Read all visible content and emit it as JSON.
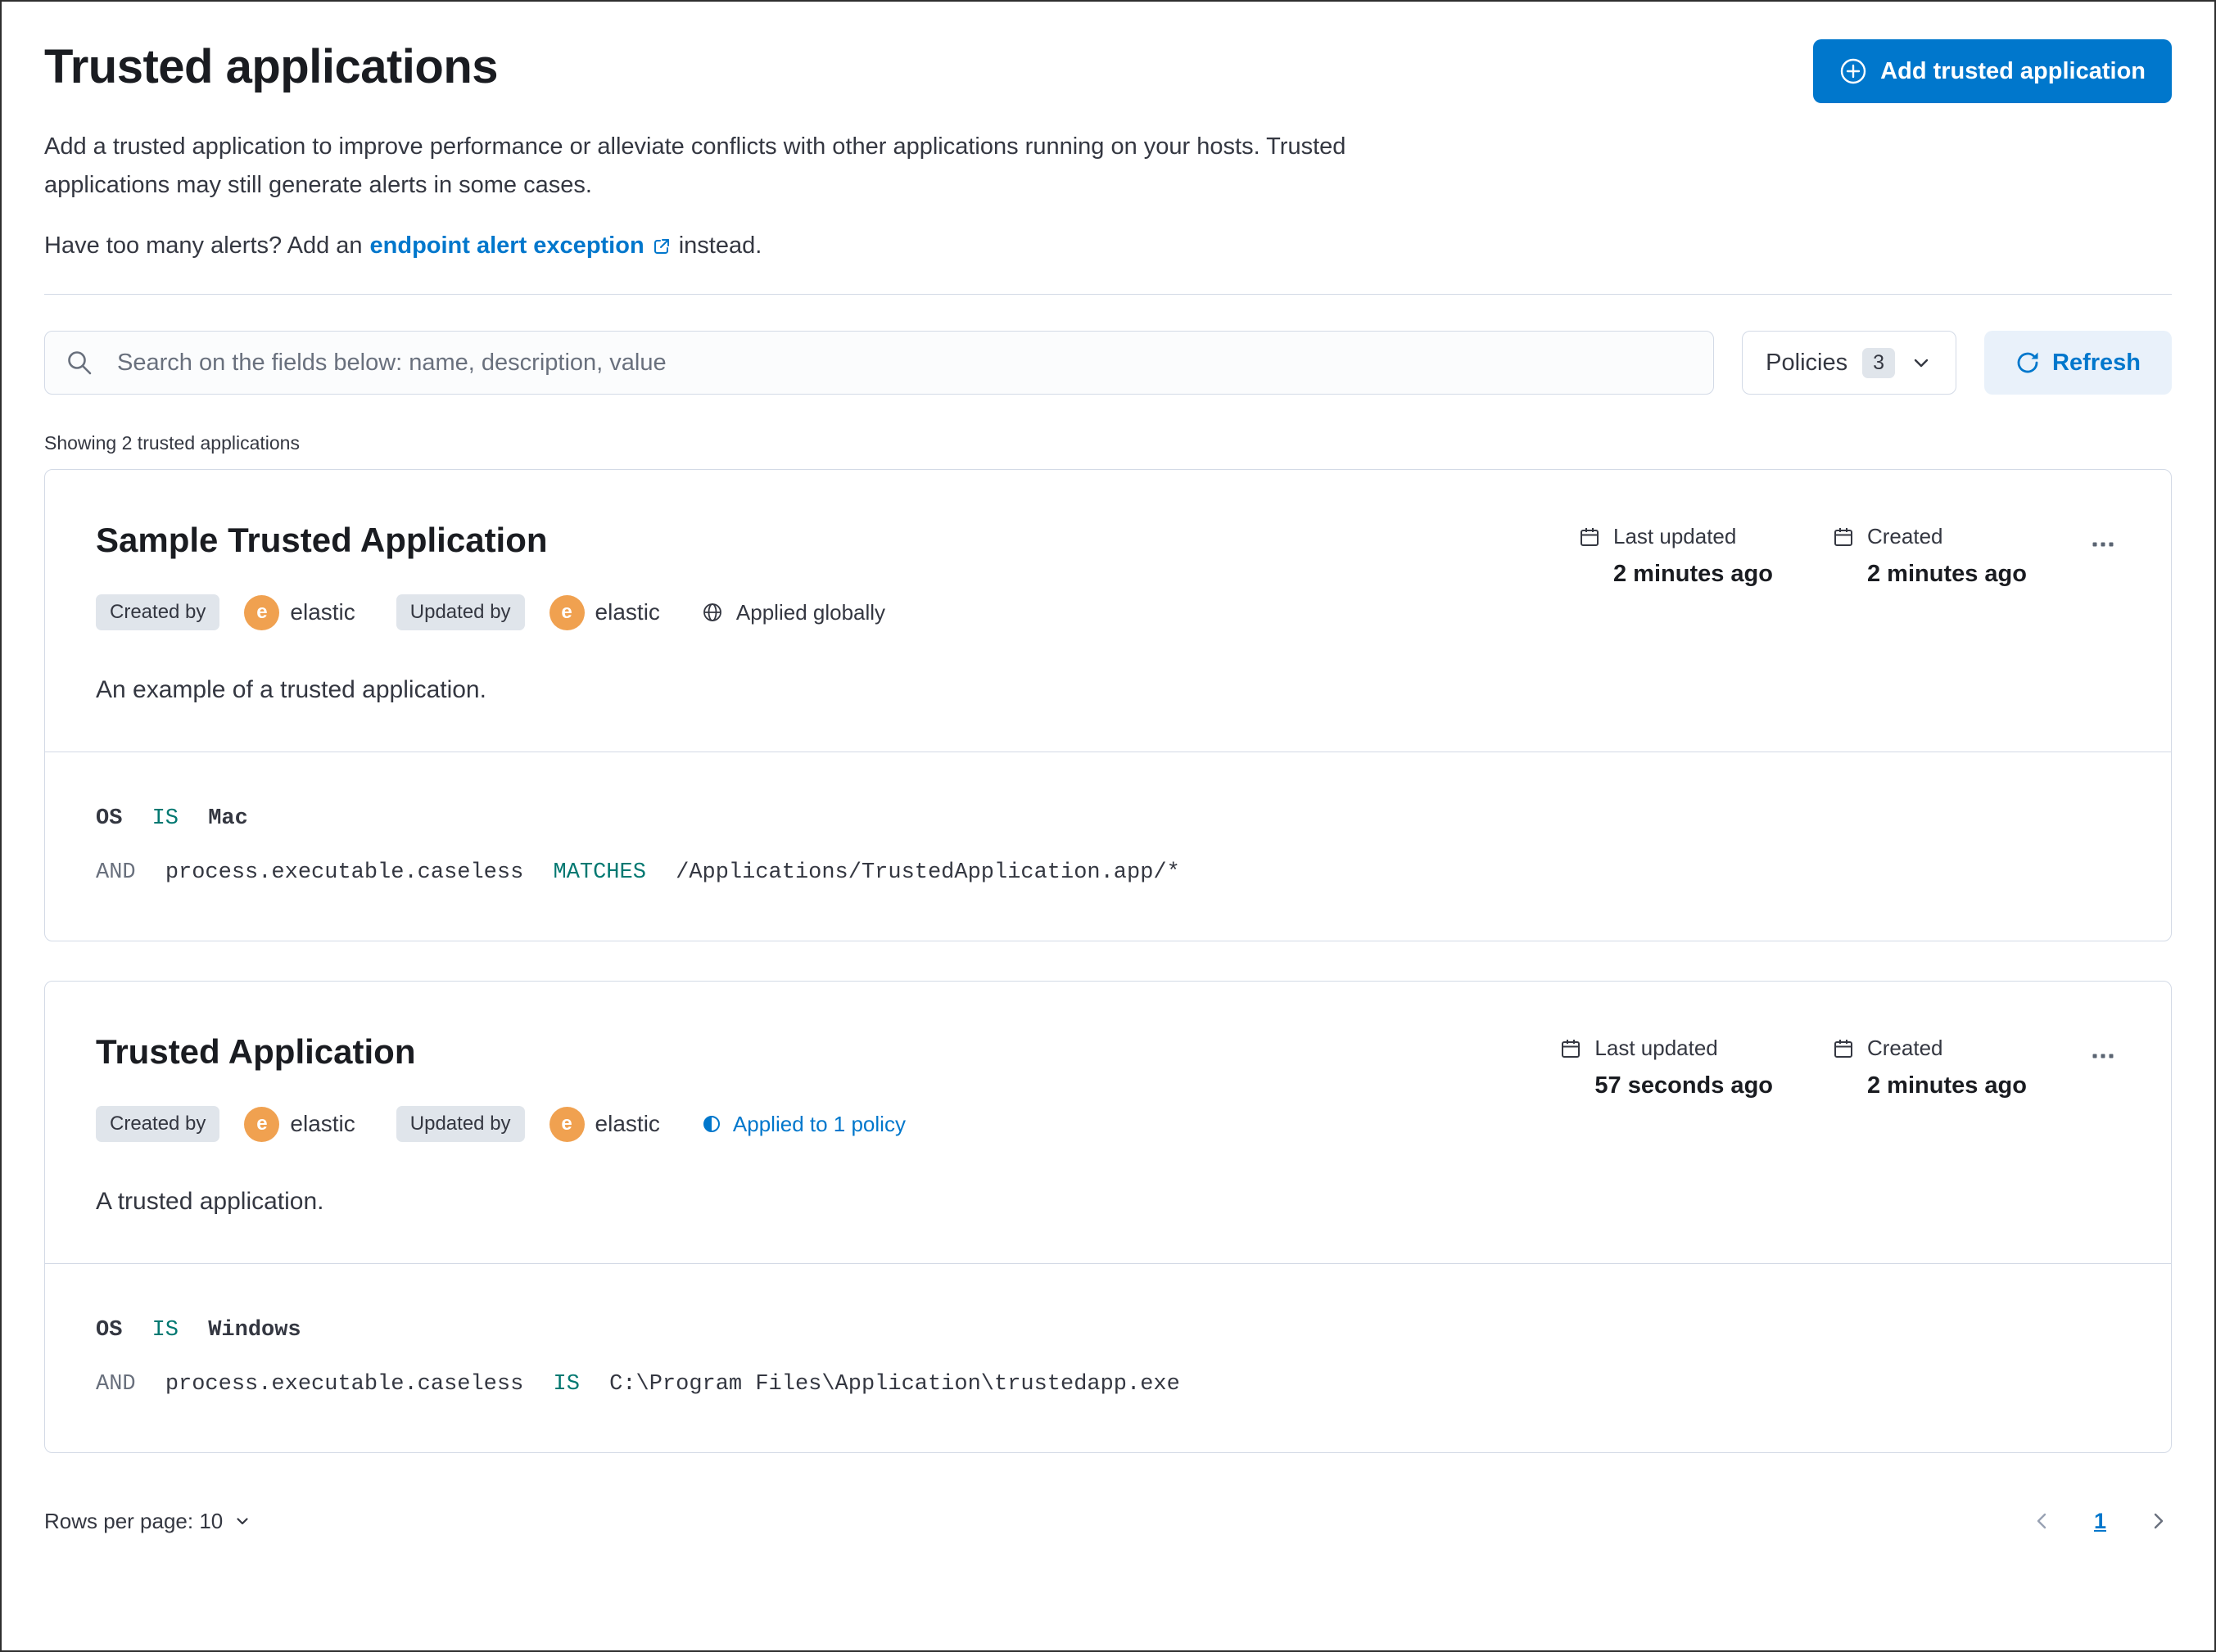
{
  "header": {
    "title": "Trusted applications",
    "add_button_label": "Add trusted application",
    "description": "Add a trusted application to improve performance or alleviate conflicts with other applications running on your hosts. Trusted applications may still generate alerts in some cases.",
    "alerts_prefix": "Have too many alerts? Add an",
    "alerts_link_label": "endpoint alert exception",
    "alerts_suffix": "instead."
  },
  "controls": {
    "search_placeholder": "Search on the fields below: name, description, value",
    "policies_label": "Policies",
    "policies_count": "3",
    "refresh_label": "Refresh",
    "showing_text": "Showing 2 trusted applications"
  },
  "cards": [
    {
      "title": "Sample Trusted Application",
      "created_by_label": "Created by",
      "created_by_avatar": "e",
      "created_by_user": "elastic",
      "updated_by_label": "Updated by",
      "updated_by_avatar": "e",
      "updated_by_user": "elastic",
      "scope_label": "Applied globally",
      "last_updated_label": "Last updated",
      "last_updated_value": "2 minutes ago",
      "created_label": "Created",
      "created_value": "2 minutes ago",
      "description": "An example of a trusted application.",
      "conditions": [
        {
          "field": "OS",
          "operator": "IS",
          "value": "Mac"
        },
        {
          "prefix": "AND",
          "field": "process.executable.caseless",
          "operator": "MATCHES",
          "value": "/Applications/TrustedApplication.app/*"
        }
      ]
    },
    {
      "title": "Trusted Application",
      "created_by_label": "Created by",
      "created_by_avatar": "e",
      "created_by_user": "elastic",
      "updated_by_label": "Updated by",
      "updated_by_avatar": "e",
      "updated_by_user": "elastic",
      "scope_label": "Applied to 1 policy",
      "last_updated_label": "Last updated",
      "last_updated_value": "57 seconds ago",
      "created_label": "Created",
      "created_value": "2 minutes ago",
      "description": "A trusted application.",
      "conditions": [
        {
          "field": "OS",
          "operator": "IS",
          "value": "Windows"
        },
        {
          "prefix": "AND",
          "field": "process.executable.caseless",
          "operator": "IS",
          "value": "C:\\Program Files\\Application\\trustedapp.exe"
        }
      ]
    }
  ],
  "footer": {
    "rows_per_page_label": "Rows per page: 10",
    "current_page": "1"
  },
  "colors": {
    "primary": "#0077CC",
    "avatar_orange": "#F0A150",
    "operator_teal": "#007871"
  }
}
